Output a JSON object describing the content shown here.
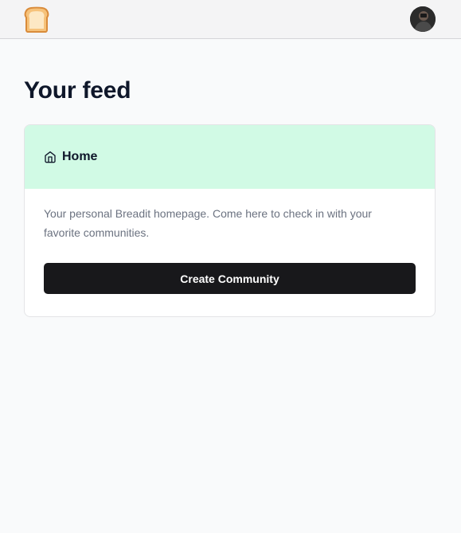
{
  "navbar": {
    "logo_icon": "bread-icon",
    "avatar_icon": "user-avatar"
  },
  "feed": {
    "title": "Your feed"
  },
  "home_card": {
    "icon": "home-icon",
    "title": "Home",
    "description": "Your personal Breadit homepage. Come here to check in with your favorite communities.",
    "button_label": "Create Community",
    "header_color": "#d1fae5"
  },
  "colors": {
    "page_background": "#f9fafb",
    "navbar_background": "#f4f4f5",
    "button_background": "#18181b",
    "text_primary": "#0f172a",
    "text_muted": "#6b7280"
  }
}
